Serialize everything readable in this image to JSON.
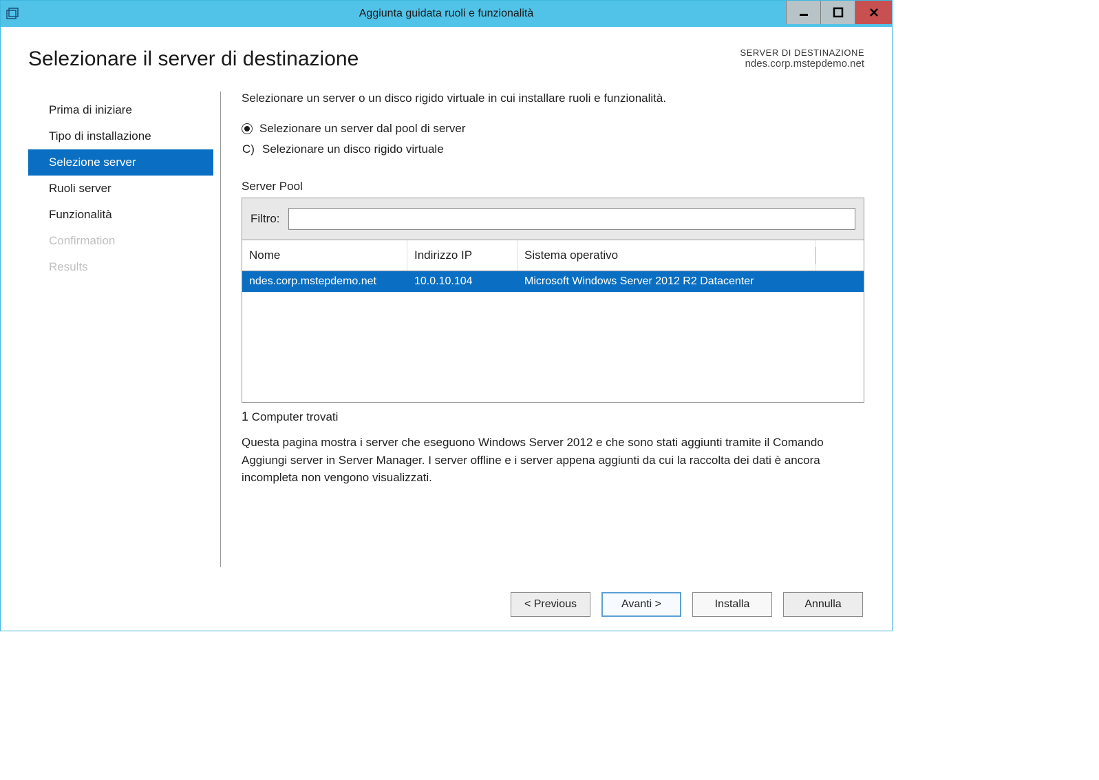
{
  "titlebar": {
    "title": "Aggiunta guidata ruoli e funzionalità"
  },
  "header": {
    "page_title": "Selezionare il server di destinazione",
    "dest_label": "SERVER DI DESTINAZIONE",
    "dest_value": "ndes.corp.mstepdemo.net"
  },
  "sidebar": {
    "items": [
      {
        "label": "Prima di iniziare"
      },
      {
        "label": "Tipo di installazione"
      },
      {
        "label": "Selezione server"
      },
      {
        "label": "Ruoli server"
      },
      {
        "label": "Funzionalità"
      },
      {
        "label": "Confirmation"
      },
      {
        "label": "Results"
      }
    ]
  },
  "main": {
    "intro": "Selezionare un server o un disco rigido virtuale in cui installare ruoli e funzionalità.",
    "option1": "Selezionare un server dal pool di server",
    "option2_marker": "C)",
    "option2": "Selezionare un disco rigido virtuale",
    "group_label": "Server Pool",
    "filter_label": "Filtro:",
    "filter_value": "",
    "columns": {
      "name": "Nome",
      "ip": "Indirizzo IP",
      "os": "Sistema operativo"
    },
    "rows": [
      {
        "name": "ndes.corp.mstepdemo.net",
        "ip": "10.0.10.104",
        "os": "Microsoft Windows Server 2012 R2 Datacenter"
      }
    ],
    "found_count": "1",
    "found_label": "Computer trovati",
    "footer_note": "Questa pagina mostra i server che eseguono Windows Server 2012 e che sono stati aggiunti tramite il Comando Aggiungi server in Server Manager. I server offline e i server appena aggiunti da cui la raccolta dei dati è ancora incompleta non vengono visualizzati."
  },
  "buttons": {
    "previous": "< Previous",
    "next": "Avanti >",
    "install": "Installa",
    "cancel": "Annulla"
  }
}
